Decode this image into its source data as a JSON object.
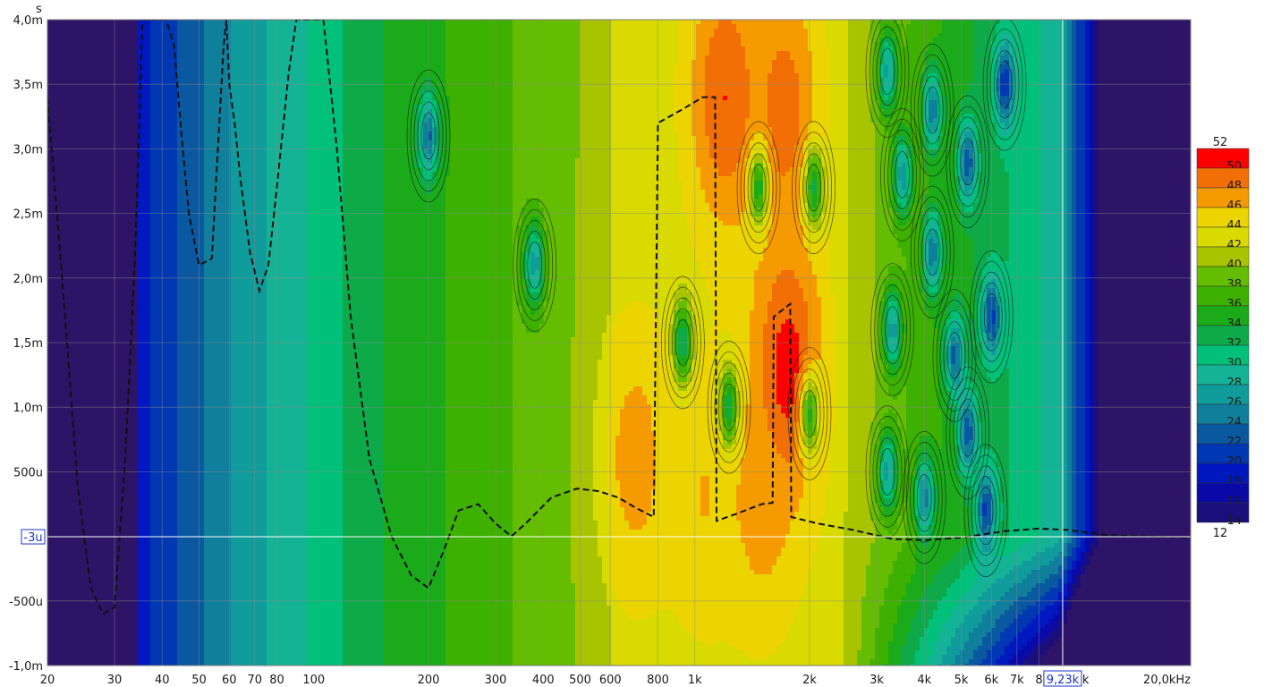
{
  "chart_data": {
    "type": "heatmap",
    "title": "",
    "xlabel": "",
    "ylabel": "",
    "y_unit_label": "s",
    "x_scale": "log",
    "xlim": [
      20,
      20000
    ],
    "ylim": [
      -0.001,
      0.004
    ],
    "x_ticks": [
      {
        "v": 20,
        "t": "20"
      },
      {
        "v": 30,
        "t": "30"
      },
      {
        "v": 40,
        "t": "40"
      },
      {
        "v": 50,
        "t": "50"
      },
      {
        "v": 60,
        "t": "60"
      },
      {
        "v": 70,
        "t": "70"
      },
      {
        "v": 80,
        "t": "80"
      },
      {
        "v": 100,
        "t": "100"
      },
      {
        "v": 200,
        "t": "200"
      },
      {
        "v": 300,
        "t": "300"
      },
      {
        "v": 400,
        "t": "400"
      },
      {
        "v": 500,
        "t": "500"
      },
      {
        "v": 600,
        "t": "600"
      },
      {
        "v": 800,
        "t": "800"
      },
      {
        "v": 1000,
        "t": "1k"
      },
      {
        "v": 2000,
        "t": "2k"
      },
      {
        "v": 3000,
        "t": "3k"
      },
      {
        "v": 4000,
        "t": "4k"
      },
      {
        "v": 5000,
        "t": "5k"
      },
      {
        "v": 6000,
        "t": "6k"
      },
      {
        "v": 7000,
        "t": "7k"
      },
      {
        "v": 8000,
        "t": "8"
      },
      {
        "v": 20000,
        "t": "20,0kHz"
      }
    ],
    "y_ticks": [
      {
        "v": 0.004,
        "t": "4,0m"
      },
      {
        "v": 0.0035,
        "t": "3,5m"
      },
      {
        "v": 0.003,
        "t": "3,0m"
      },
      {
        "v": 0.0025,
        "t": "2,5m"
      },
      {
        "v": 0.002,
        "t": "2,0m"
      },
      {
        "v": 0.0015,
        "t": "1,5m"
      },
      {
        "v": 0.001,
        "t": "1,0m"
      },
      {
        "v": 0.0005,
        "t": "500u"
      },
      {
        "v": -0.0005,
        "t": "-500u"
      },
      {
        "v": -0.001,
        "t": "-1,0m"
      }
    ],
    "cursor": {
      "x": 9230,
      "y": -3e-06,
      "x_label": "9,23k",
      "x_suffix": "k",
      "y_label": "-3u"
    },
    "color_scale": {
      "min_label": "12",
      "max_label": "52",
      "bands": [
        {
          "v": 50,
          "label": "50",
          "color": "#ff0000"
        },
        {
          "v": 48,
          "label": "48",
          "color": "#f26f06"
        },
        {
          "v": 46,
          "label": "46",
          "color": "#f59a00"
        },
        {
          "v": 44,
          "label": "44",
          "color": "#ecd400"
        },
        {
          "v": 42,
          "label": "42",
          "color": "#d9da00"
        },
        {
          "v": 40,
          "label": "40",
          "color": "#a8c400"
        },
        {
          "v": 38,
          "label": "38",
          "color": "#64bd00"
        },
        {
          "v": 36,
          "label": "36",
          "color": "#3eb000"
        },
        {
          "v": 34,
          "label": "34",
          "color": "#1aaa1a"
        },
        {
          "v": 32,
          "label": "32",
          "color": "#0eaa4a"
        },
        {
          "v": 30,
          "label": "30",
          "color": "#00c07a"
        },
        {
          "v": 28,
          "label": "28",
          "color": "#15b395"
        },
        {
          "v": 26,
          "label": "26",
          "color": "#109c9a"
        },
        {
          "v": 24,
          "label": "24",
          "color": "#0f7f9c"
        },
        {
          "v": 22,
          "label": "22",
          "color": "#0a58a0"
        },
        {
          "v": 20,
          "label": "20",
          "color": "#0037b2"
        },
        {
          "v": 18,
          "label": "18",
          "color": "#0018c0"
        },
        {
          "v": 16,
          "label": "16",
          "color": "#0a0aa8"
        },
        {
          "v": 14,
          "label": "14",
          "color": "#1a0f7a"
        }
      ],
      "top_color": "#ff0000",
      "floor_color": "#2e1466"
    },
    "background_color": "#2e1466",
    "hot_regions": [
      {
        "f": 1200,
        "t": 0.0034,
        "level": 50
      },
      {
        "f": 1750,
        "t": 0.0013,
        "level": 51
      },
      {
        "f": 1720,
        "t": 0.0033,
        "level": 49
      },
      {
        "f": 700,
        "t": 0.0006,
        "level": 47
      },
      {
        "f": 1050,
        "t": 0.0003,
        "level": 46
      },
      {
        "f": 1500,
        "t": 0.0003,
        "level": 47
      }
    ],
    "minima": [
      {
        "f": 200,
        "t": 0.0031
      },
      {
        "f": 380,
        "t": 0.0021
      },
      {
        "f": 930,
        "t": 0.0015
      },
      {
        "f": 1230,
        "t": 0.001
      },
      {
        "f": 1470,
        "t": 0.0027
      },
      {
        "f": 2050,
        "t": 0.0027
      },
      {
        "f": 2000,
        "t": 0.00095
      },
      {
        "f": 3200,
        "t": 0.0036
      },
      {
        "f": 3500,
        "t": 0.0028
      },
      {
        "f": 4200,
        "t": 0.0033
      },
      {
        "f": 5200,
        "t": 0.0029
      },
      {
        "f": 4200,
        "t": 0.0022
      },
      {
        "f": 3300,
        "t": 0.0016
      },
      {
        "f": 4800,
        "t": 0.0014
      },
      {
        "f": 3200,
        "t": 0.0005
      },
      {
        "f": 4000,
        "t": 0.0003
      },
      {
        "f": 5800,
        "t": 0.0002
      },
      {
        "f": 6500,
        "t": 0.0035
      },
      {
        "f": 6000,
        "t": 0.0017
      },
      {
        "f": 5200,
        "t": 0.0008
      }
    ],
    "dashed_curve": [
      [
        20,
        0.0034
      ],
      [
        22,
        0.0019
      ],
      [
        24,
        0.0004
      ],
      [
        26,
        -0.0004
      ],
      [
        28,
        -0.0006
      ],
      [
        30,
        -0.00055
      ],
      [
        32,
        0.0006
      ],
      [
        34,
        0.0022
      ],
      [
        35.5,
        0.004
      ],
      [
        41,
        0.004
      ],
      [
        43,
        0.0038
      ],
      [
        45,
        0.0031
      ],
      [
        47,
        0.0025
      ],
      [
        50,
        0.0021
      ],
      [
        54,
        0.00215
      ],
      [
        58,
        0.0038
      ],
      [
        59,
        0.004
      ],
      [
        60,
        0.0035
      ],
      [
        62,
        0.0032
      ],
      [
        64,
        0.0028
      ],
      [
        68,
        0.0022
      ],
      [
        72,
        0.0019
      ],
      [
        76,
        0.0021
      ],
      [
        80,
        0.0027
      ],
      [
        86,
        0.0036
      ],
      [
        90,
        0.004
      ],
      [
        106,
        0.004
      ],
      [
        115,
        0.003
      ],
      [
        125,
        0.0017
      ],
      [
        140,
        0.0006
      ],
      [
        160,
        0.0
      ],
      [
        180,
        -0.0003
      ],
      [
        200,
        -0.0004
      ],
      [
        220,
        -0.0001
      ],
      [
        240,
        0.0002
      ],
      [
        270,
        0.00025
      ],
      [
        300,
        0.0001
      ],
      [
        330,
        0.0
      ],
      [
        360,
        0.0001
      ],
      [
        420,
        0.0003
      ],
      [
        490,
        0.00037
      ],
      [
        560,
        0.00035
      ],
      [
        630,
        0.0003
      ],
      [
        700,
        0.00022
      ],
      [
        780,
        0.00015
      ],
      [
        800,
        0.0032
      ],
      [
        920,
        0.0033
      ],
      [
        1050,
        0.0034
      ],
      [
        1130,
        0.0034
      ],
      [
        1140,
        0.00012
      ],
      [
        1300,
        0.00018
      ],
      [
        1500,
        0.00025
      ],
      [
        1600,
        0.00026
      ],
      [
        1610,
        0.0017
      ],
      [
        1780,
        0.0018
      ],
      [
        1790,
        0.00015
      ],
      [
        2100,
        0.0001
      ],
      [
        2600,
        5e-05
      ],
      [
        3300,
        -2e-05
      ],
      [
        4000,
        -3e-05
      ],
      [
        5000,
        -1e-05
      ],
      [
        6500,
        4e-05
      ],
      [
        8000,
        6e-05
      ],
      [
        9500,
        5e-05
      ],
      [
        12000,
        1e-05
      ],
      [
        20000,
        -1e-05
      ]
    ]
  }
}
